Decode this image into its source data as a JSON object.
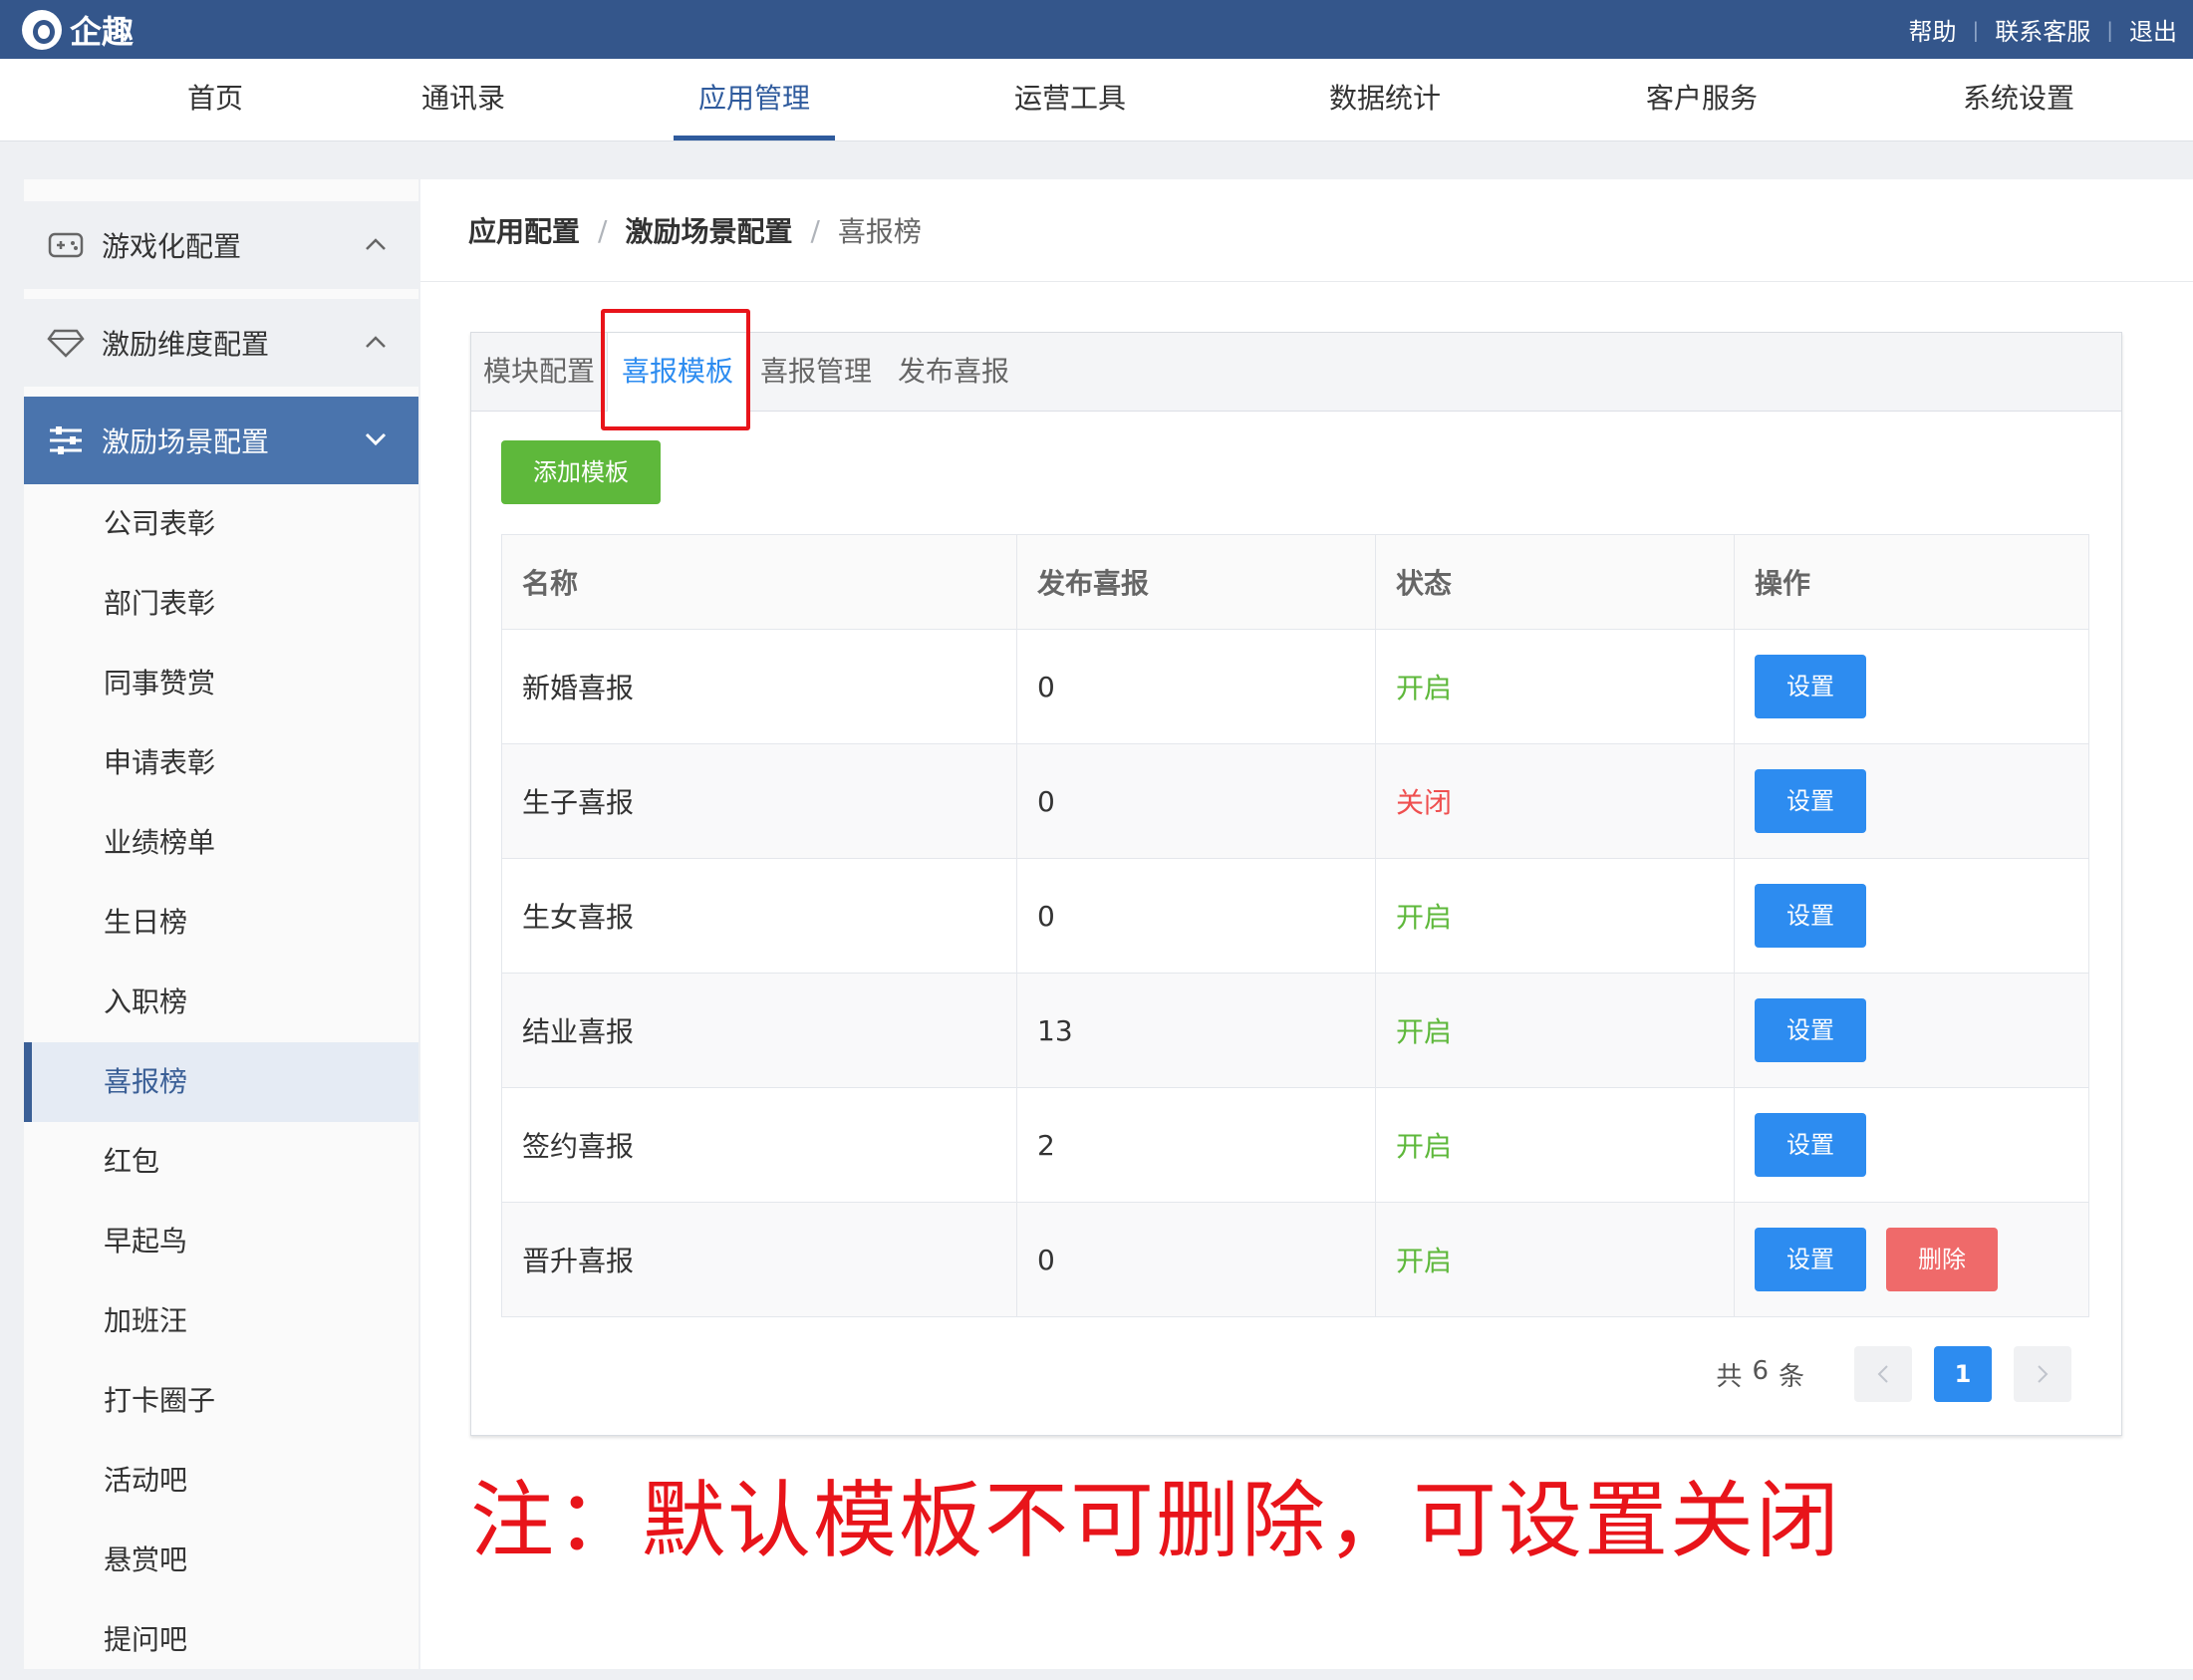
{
  "header": {
    "brand": "企趣",
    "links": [
      "帮助",
      "联系客服",
      "退出"
    ]
  },
  "nav": {
    "items": [
      "首页",
      "通讯录",
      "应用管理",
      "运营工具",
      "数据统计",
      "客户服务",
      "系统设置"
    ],
    "active": "应用管理"
  },
  "sidebar": {
    "groups": [
      {
        "label": "游戏化配置",
        "icon": "gamepad-icon",
        "expanded": false
      },
      {
        "label": "激励维度配置",
        "icon": "diamond-icon",
        "expanded": false
      },
      {
        "label": "激励场景配置",
        "icon": "sliders-icon",
        "expanded": true
      }
    ],
    "items": [
      "公司表彰",
      "部门表彰",
      "同事赞赏",
      "申请表彰",
      "业绩榜单",
      "生日榜",
      "入职榜",
      "喜报榜",
      "红包",
      "早起鸟",
      "加班汪",
      "打卡圈子",
      "活动吧",
      "悬赏吧",
      "提问吧"
    ],
    "active_item": "喜报榜"
  },
  "breadcrumb": [
    "应用配置",
    "激励场景配置",
    "喜报榜"
  ],
  "tabs": {
    "items": [
      "模块配置",
      "喜报模板",
      "喜报管理",
      "发布喜报"
    ],
    "active": "喜报模板"
  },
  "toolbar": {
    "add_label": "添加模板"
  },
  "table": {
    "columns": [
      "名称",
      "发布喜报",
      "状态",
      "操作"
    ],
    "rows": [
      {
        "name": "新婚喜报",
        "count": "0",
        "status": "开启",
        "status_on": true,
        "actions": [
          "设置"
        ]
      },
      {
        "name": "生子喜报",
        "count": "0",
        "status": "关闭",
        "status_on": false,
        "actions": [
          "设置"
        ]
      },
      {
        "name": "生女喜报",
        "count": "0",
        "status": "开启",
        "status_on": true,
        "actions": [
          "设置"
        ]
      },
      {
        "name": "结业喜报",
        "count": "13",
        "status": "开启",
        "status_on": true,
        "actions": [
          "设置"
        ]
      },
      {
        "name": "签约喜报",
        "count": "2",
        "status": "开启",
        "status_on": true,
        "actions": [
          "设置"
        ]
      },
      {
        "name": "晋升喜报",
        "count": "0",
        "status": "开启",
        "status_on": true,
        "actions": [
          "设置",
          "删除"
        ]
      }
    ]
  },
  "pagination": {
    "total_prefix": "共",
    "total": "6",
    "total_suffix": "条",
    "current_page": "1"
  },
  "note": "注：默认模板不可删除，可设置关闭",
  "colors": {
    "topbar": "#34568b",
    "accent": "#2d8cf0",
    "add_button": "#5eb83b",
    "status_on": "#5eb83b",
    "status_off": "#ef4f4f",
    "delete_button": "#ef6a6a",
    "annotation": "#e8141a"
  }
}
